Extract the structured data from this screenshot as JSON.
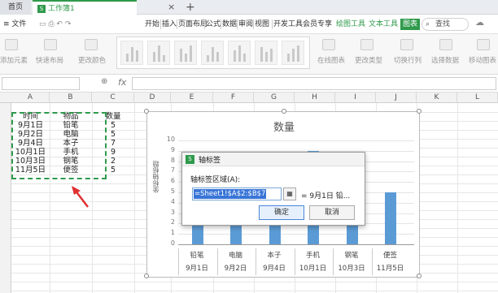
{
  "titlebar": {
    "home_tab": "首页",
    "doc_tab": "工作簿1",
    "doc_icon": "S",
    "close_glyph": "×",
    "new_tab": "+"
  },
  "menu": {
    "file": "≡ 文件"
  },
  "ribbon": {
    "tabs": [
      "开始",
      "插入",
      "页面布局",
      "公式",
      "数据",
      "审阅",
      "视图",
      "开发工具"
    ],
    "member": "会员专享",
    "chart_tools": "绘图工具",
    "text_tools": "文本工具",
    "active_tab": "图表",
    "search": "查找",
    "buttons": [
      "添加元素",
      "快速布局",
      "更改颜色",
      "在线图表",
      "更改类型",
      "切换行列",
      "选择数据",
      "移动图表"
    ]
  },
  "formula": {
    "fx": "fx",
    "zoom": "⊕"
  },
  "sheet": {
    "columns": [
      "A",
      "B",
      "C",
      "D",
      "E",
      "F",
      "G",
      "H",
      "I",
      "J",
      "K",
      "L"
    ],
    "header": {
      "a": "时间",
      "b": "物品",
      "c": "数量"
    },
    "rows": [
      {
        "a": "9月1日",
        "b": "铅笔",
        "c": "5"
      },
      {
        "a": "9月2日",
        "b": "电脑",
        "c": "5"
      },
      {
        "a": "9月4日",
        "b": "本子",
        "c": "7"
      },
      {
        "a": "10月1日",
        "b": "手机",
        "c": "9"
      },
      {
        "a": "10月3日",
        "b": "钢笔",
        "c": "2"
      },
      {
        "a": "11月5日",
        "b": "便签",
        "c": "5"
      }
    ]
  },
  "chart_data": {
    "type": "bar",
    "title": "数量",
    "ylabel": "坐标轴标题",
    "ylim": [
      0,
      10
    ],
    "yticks": [
      "0",
      "1",
      "2",
      "3",
      "4",
      "5",
      "6",
      "7",
      "8",
      "9",
      "10"
    ],
    "categories": [
      "铅笔",
      "电脑",
      "本子",
      "手机",
      "钢笔",
      "便签"
    ],
    "dates": [
      "9月1日",
      "9月2日",
      "9月4日",
      "10月1日",
      "10月3日",
      "11月5日"
    ],
    "values": [
      5,
      5,
      7,
      9,
      2,
      5
    ],
    "bar_color": "#5b9bd5",
    "grid": true
  },
  "dialog": {
    "title": "轴标签",
    "logo": "S",
    "label": "轴标签区域(A):",
    "input_value": "=Sheet1!$A$2:$B$7",
    "ref_icon": "▦",
    "preview": "= 9月1日 铅...",
    "ok": "确定",
    "cancel": "取消"
  },
  "colors": {
    "accent": "#2f9a4c",
    "selection": "#3875d7",
    "arrow": "#e03030"
  }
}
